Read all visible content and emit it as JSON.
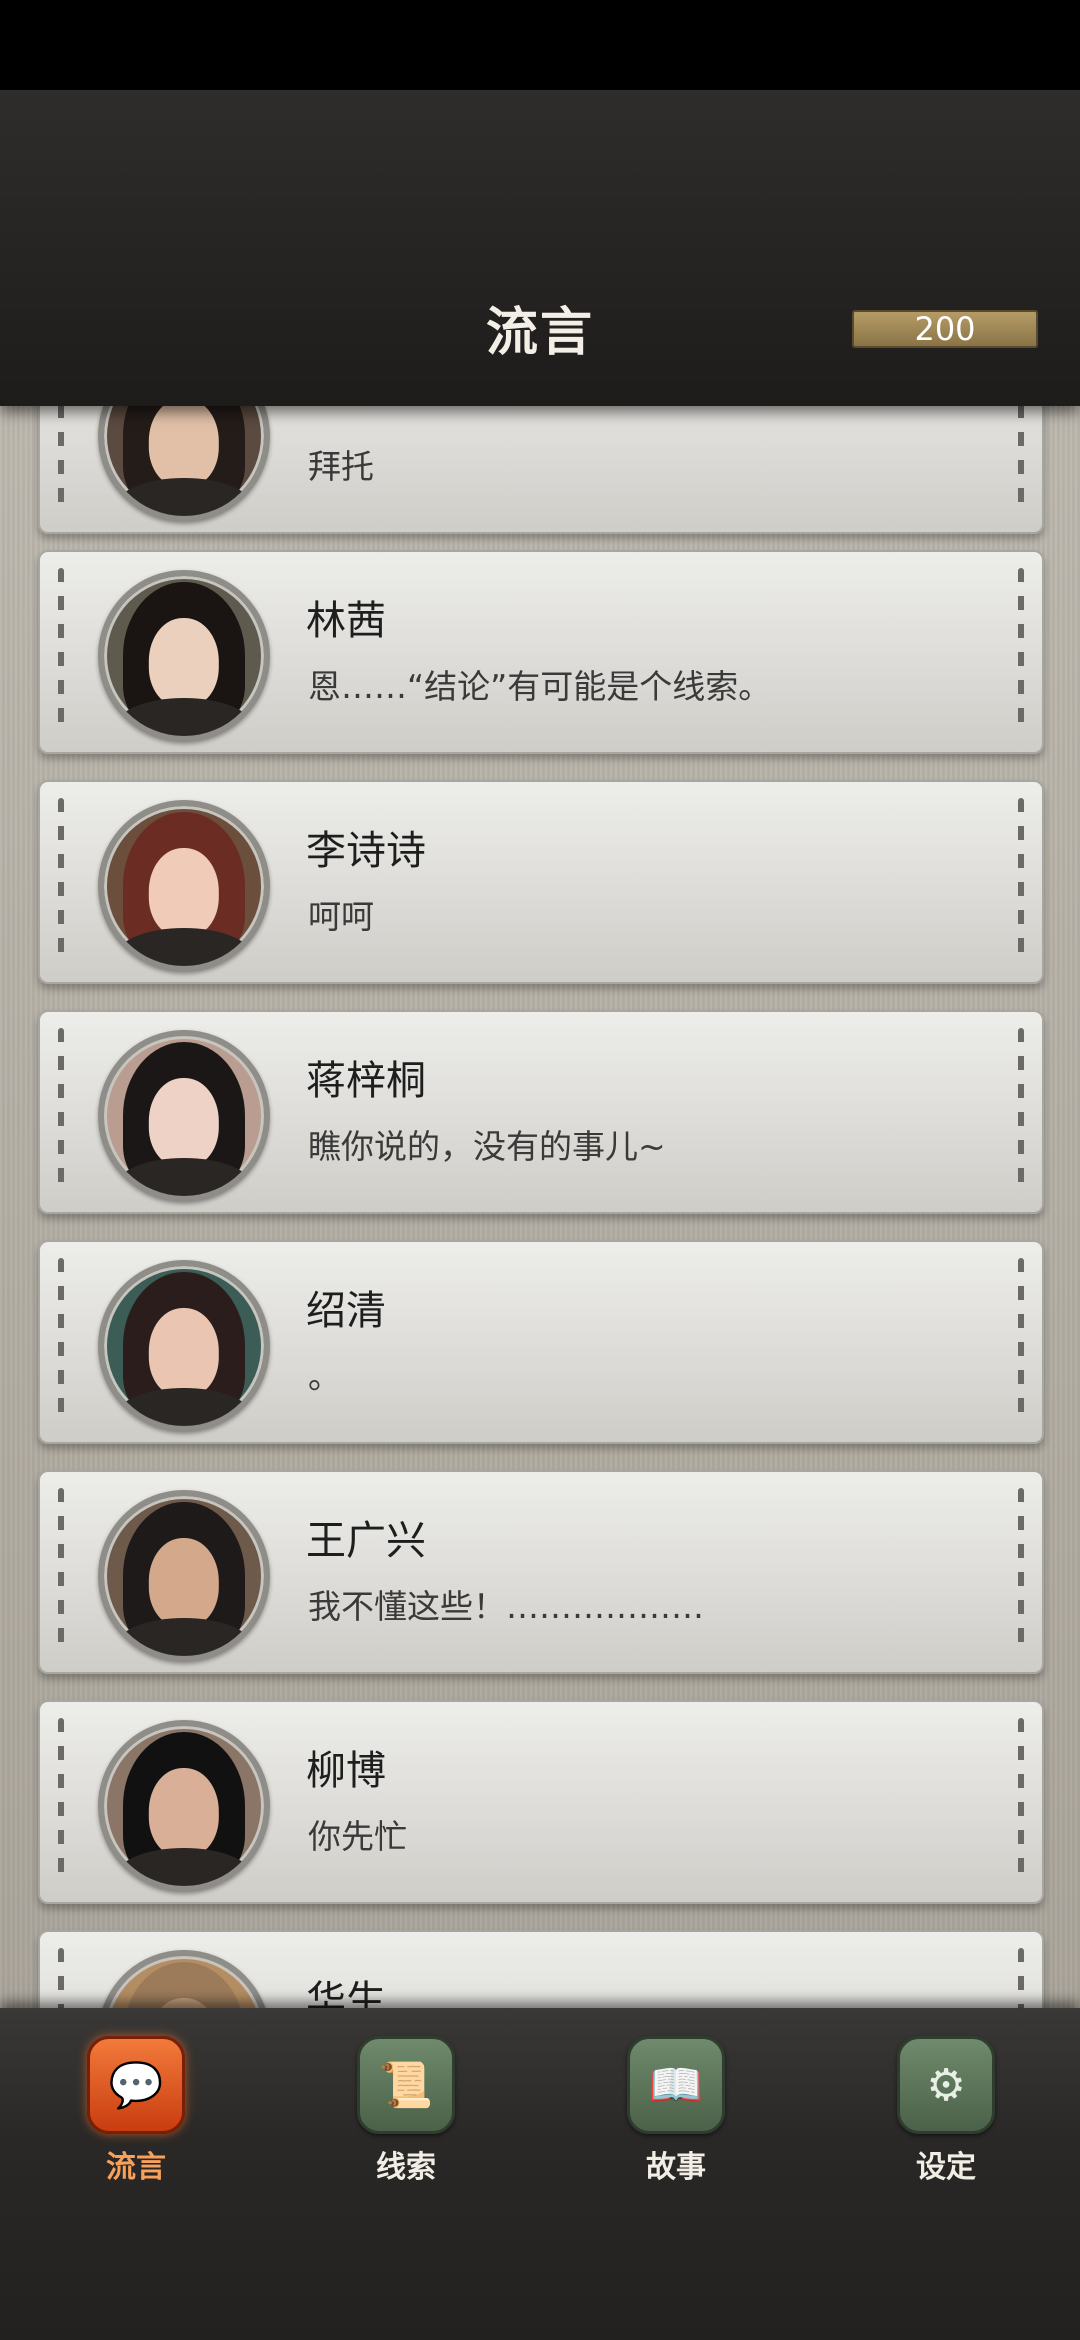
{
  "header": {
    "title": "流言",
    "coins": "200"
  },
  "messages": [
    {
      "name": "",
      "text": "拜托",
      "hair": "#231c19",
      "skin": "#e2c0a8",
      "bg": "#5a4a40"
    },
    {
      "name": "林茜",
      "text": "恩……“结论”有可能是个线索。",
      "hair": "#1a1412",
      "skin": "#ead0bd",
      "bg": "#5f5a4e"
    },
    {
      "name": "李诗诗",
      "text": "呵呵",
      "hair": "#6b2d23",
      "skin": "#f0cbb8",
      "bg": "#6b4e3c"
    },
    {
      "name": "蒋梓桐",
      "text": "瞧你说的，没有的事儿~",
      "hair": "#1b1716",
      "skin": "#efd2c6",
      "bg": "#b99d90"
    },
    {
      "name": "绍清",
      "text": "。",
      "hair": "#2a1d1c",
      "skin": "#e9c5b2",
      "bg": "#3c5c56"
    },
    {
      "name": "王广兴",
      "text": "我不懂这些！………………",
      "hair": "#1d1a19",
      "skin": "#d4a88a",
      "bg": "#6d5a4b"
    },
    {
      "name": "柳博",
      "text": "你先忙",
      "hair": "#111",
      "skin": "#d9b097",
      "bg": "#8a7566"
    },
    {
      "name": "华生",
      "text": "",
      "hair": "#9c7b5a",
      "skin": "#c8a27e",
      "bg": "#b58d63"
    }
  ],
  "nav": {
    "items": [
      {
        "label": "流言",
        "icon": "chat-bubble-icon",
        "active": true
      },
      {
        "label": "线索",
        "icon": "paper-note-icon",
        "active": false
      },
      {
        "label": "故事",
        "icon": "book-icon",
        "active": false
      },
      {
        "label": "设定",
        "icon": "gear-icon",
        "active": false
      }
    ]
  }
}
